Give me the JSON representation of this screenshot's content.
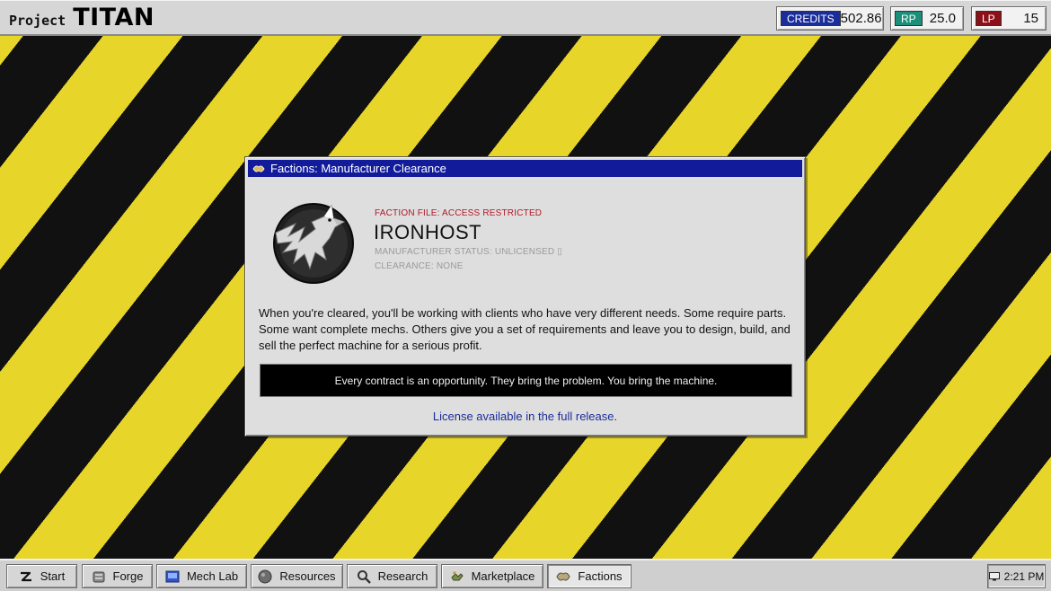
{
  "app": {
    "brand_small": "Project",
    "brand_big": "TITAN"
  },
  "stats": {
    "credits": {
      "label": "CREDITS",
      "value": "502.86",
      "color": "#1b2d9b"
    },
    "rp": {
      "label": "RP",
      "value": "25.0",
      "color": "#1c8f7a"
    },
    "lp": {
      "label": "LP",
      "value": "15",
      "color": "#8c1017"
    }
  },
  "dialog": {
    "title": "Factions: Manufacturer Clearance",
    "title_icon": "factions-icon",
    "emblem_icon": "eagle-emblem-icon",
    "kicker": "FACTION FILE: ACCESS RESTRICTED",
    "faction_name": "IRONHOST",
    "status": "MANUFACTURER STATUS: UNLICENSED ▯",
    "clearance": "CLEARANCE: NONE",
    "description": "When you're cleared, you'll be working with clients who have very different needs. Some require parts. Some want complete mechs. Others give you a set of requirements and leave you to design, build, and sell the perfect machine for a serious profit.",
    "quote": "Every contract is an opportunity. They bring the problem. You bring the machine.",
    "license_link": "License available in the full release."
  },
  "taskbar": {
    "items": [
      {
        "label": "Start",
        "icon": "start-icon"
      },
      {
        "label": "Forge",
        "icon": "forge-icon"
      },
      {
        "label": "Mech Lab",
        "icon": "mech-lab-icon"
      },
      {
        "label": "Resources",
        "icon": "resources-icon"
      },
      {
        "label": "Research",
        "icon": "research-icon"
      },
      {
        "label": "Marketplace",
        "icon": "marketplace-icon"
      },
      {
        "label": "Factions",
        "icon": "factions-icon",
        "active": true
      }
    ],
    "clock": "2:21 PM"
  }
}
